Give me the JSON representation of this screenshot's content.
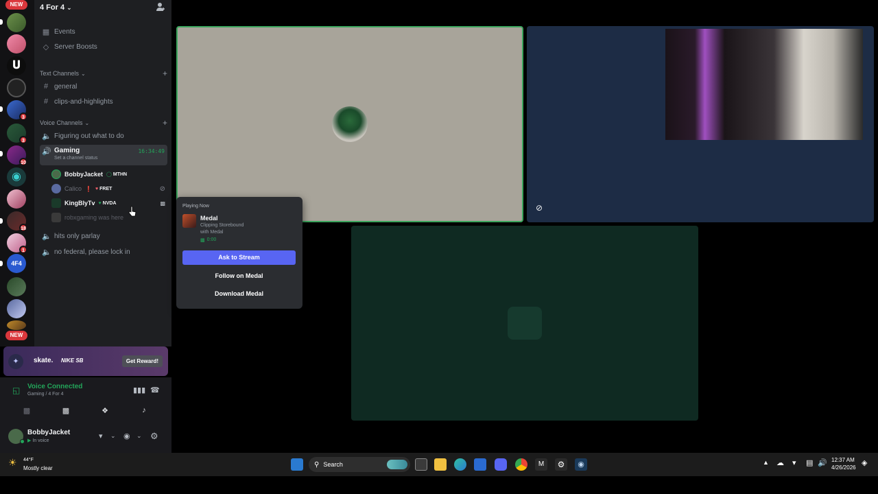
{
  "server": {
    "name": "4 For 4",
    "new_label": "NEW",
    "new_bottom_label": "NEW",
    "badges": [
      "3",
      "3",
      "10",
      "18",
      "1"
    ],
    "icon4f4": "4F4"
  },
  "sidebar": {
    "items": [
      {
        "label": "Events",
        "icon": "calendar-icon"
      },
      {
        "label": "Server Boosts",
        "icon": "boost-icon"
      }
    ],
    "text_category": "Text Channels",
    "text_channels": [
      "general",
      "clips-and-highlights"
    ],
    "voice_category": "Voice Channels",
    "voice_channels_top": [
      "Figuring out what to do"
    ],
    "active_channel": {
      "name": "Gaming",
      "timer": "16:34:49",
      "status": "Set a channel status"
    },
    "users": [
      {
        "name": "BobbyJacket",
        "tag": "MTHN",
        "muted": false
      },
      {
        "name": "Calico",
        "tag": "FRET",
        "muted": true
      },
      {
        "name": "KingBlyTv",
        "tag": "NVDA",
        "muted": false
      },
      {
        "name": "robxgaming was here",
        "tag": "",
        "muted": true
      }
    ],
    "voice_channels_bottom": [
      "hits only parlay",
      "no federal, please lock in"
    ]
  },
  "promo": {
    "brand": "skate.",
    "partner": "NIKE SB",
    "button": "Get Reward!"
  },
  "voice": {
    "status": "Voice Connected",
    "location": "Gaming / 4 For 4"
  },
  "user_panel": {
    "name": "BobbyJacket",
    "status": "In voice"
  },
  "popup": {
    "heading": "Playing Now",
    "game": "Medal",
    "detail1": "Clipping Storebound",
    "detail2": "with Medal",
    "elapsed": "0:00",
    "ask_stream": "Ask to Stream",
    "follow": "Follow on Medal",
    "download": "Download Medal"
  },
  "taskbar": {
    "weather_temp": "44°F",
    "weather_desc": "Mostly clear",
    "search": "Search",
    "time": "12:37 AM",
    "date": "4/26/2026"
  },
  "colors": {
    "accent": "#5865f2",
    "speaking": "#3ba55d",
    "voice_green": "#23a55a"
  }
}
